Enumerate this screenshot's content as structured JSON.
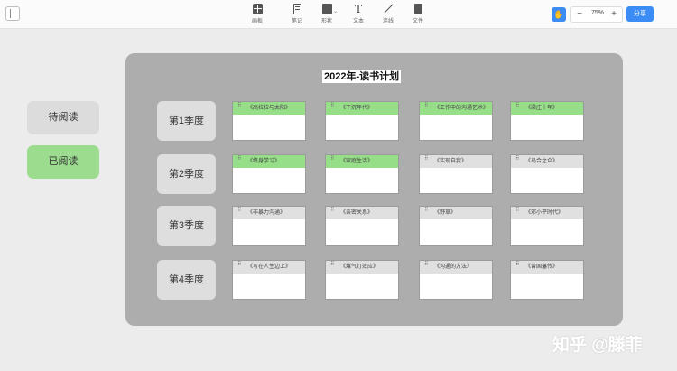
{
  "toolbar": {
    "tools": [
      {
        "icon": "board-icon",
        "label": "画板"
      },
      {
        "icon": "note-icon",
        "label": "笔记"
      },
      {
        "icon": "shape-icon",
        "label": "形状"
      },
      {
        "icon": "text-icon",
        "label": "文本"
      },
      {
        "icon": "line-icon",
        "label": "连线"
      },
      {
        "icon": "file-icon",
        "label": "文件"
      }
    ],
    "text_glyph": "T",
    "zoom": "75%",
    "zoom_minus": "−",
    "zoom_plus": "+",
    "share_label": "分享",
    "hand_glyph": "✋"
  },
  "status": {
    "unread": "待阅读",
    "read": "已阅读",
    "unread_color": "#dcdcdc",
    "read_color": "#9bdc8f"
  },
  "board": {
    "title": "2022年-读书计划",
    "quarters": [
      {
        "label": "第1季度",
        "books": [
          {
            "title": "《高拉拉与太阳》",
            "read": true
          },
          {
            "title": "《下沉年代》",
            "read": true
          },
          {
            "title": "《工作中的沟通艺术》",
            "read": true
          },
          {
            "title": "《梁庄十年》",
            "read": true
          }
        ]
      },
      {
        "label": "第2季度",
        "books": [
          {
            "title": "《终身学习》",
            "read": true
          },
          {
            "title": "《家庭生活》",
            "read": true
          },
          {
            "title": "《实现自我》",
            "read": false
          },
          {
            "title": "《乌合之众》",
            "read": false
          }
        ]
      },
      {
        "label": "第3季度",
        "books": [
          {
            "title": "《非暴力沟通》",
            "read": false
          },
          {
            "title": "《亲密关系》",
            "read": false
          },
          {
            "title": "《野草》",
            "read": false
          },
          {
            "title": "《邓小平时代》",
            "read": false
          }
        ]
      },
      {
        "label": "第4季度",
        "books": [
          {
            "title": "《写在人生边上》",
            "read": false
          },
          {
            "title": "《煤气灯效应》",
            "read": false
          },
          {
            "title": "《沟通的方法》",
            "read": false
          },
          {
            "title": "《曾国藩传》",
            "read": false
          }
        ]
      }
    ]
  },
  "watermark": "知乎 @滕菲"
}
